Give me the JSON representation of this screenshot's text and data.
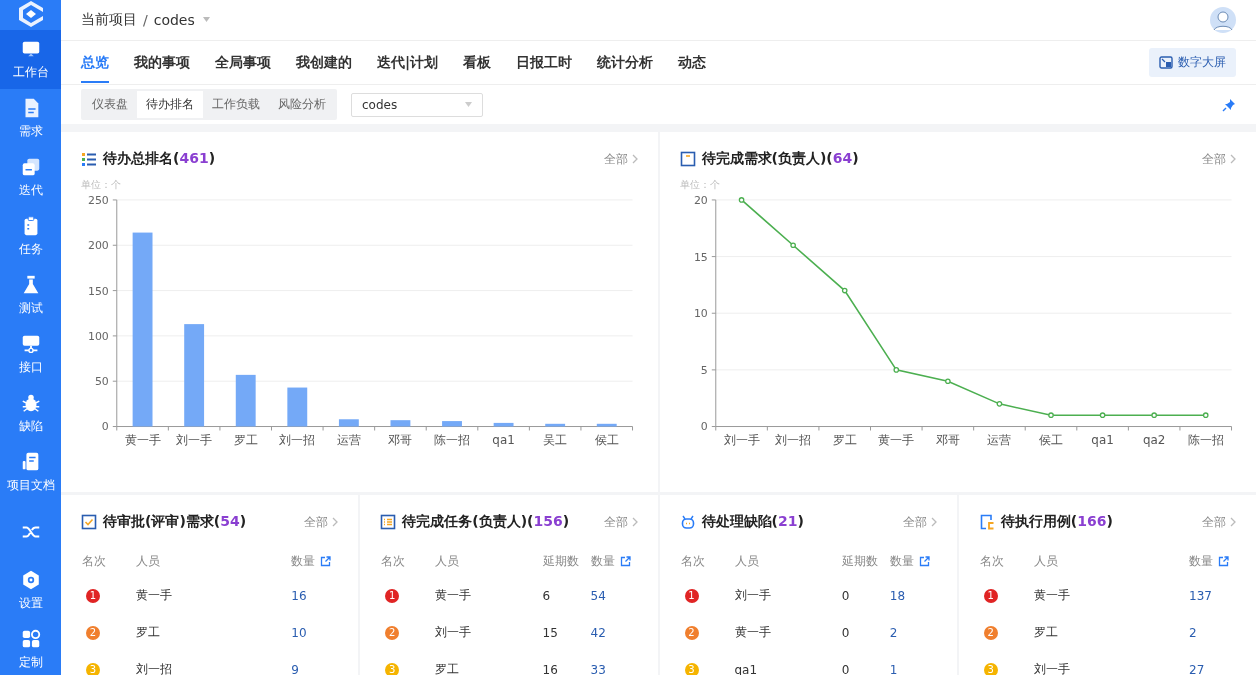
{
  "sidebar": {
    "items": [
      {
        "label": "工作台",
        "selected": true
      },
      {
        "label": "需求",
        "selected": false
      },
      {
        "label": "迭代",
        "selected": false
      },
      {
        "label": "任务",
        "selected": false
      },
      {
        "label": "测试",
        "selected": false
      },
      {
        "label": "接口",
        "selected": false
      },
      {
        "label": "缺陷",
        "selected": false
      },
      {
        "label": "项目文档",
        "selected": false
      },
      {
        "selected": false
      },
      {
        "label": "设置",
        "selected": false
      },
      {
        "label": "定制",
        "selected": false
      }
    ]
  },
  "header": {
    "project_label": "当前项目",
    "separator": "/",
    "project": "codes"
  },
  "tabs": [
    {
      "label": "总览",
      "selected": true
    },
    {
      "label": "我的事项",
      "selected": false
    },
    {
      "label": "全局事项",
      "selected": false
    },
    {
      "label": "我创建的",
      "selected": false
    },
    {
      "label": "迭代|计划",
      "selected": false
    },
    {
      "label": "看板",
      "selected": false
    },
    {
      "label": "日报工时",
      "selected": false
    },
    {
      "label": "统计分析",
      "selected": false
    },
    {
      "label": "动态",
      "selected": false
    }
  ],
  "big_screen_button": "数字大屏",
  "subtabs": [
    {
      "label": "仪表盘",
      "selected": false
    },
    {
      "label": "待办排名",
      "selected": true
    },
    {
      "label": "工作负载",
      "selected": false
    },
    {
      "label": "风险分析",
      "selected": false
    }
  ],
  "project_select": {
    "value": "codes"
  },
  "charts": [
    {
      "title": "待办总排名",
      "open": "(",
      "count": "461",
      "close": ")",
      "more": "全部",
      "unit": "单位：个",
      "chart_data": {
        "type": "bar",
        "categories": [
          "黄一手",
          "刘一手",
          "罗工",
          "刘一招",
          "运营",
          "邓哥",
          "陈一招",
          "qa1",
          "吴工",
          "侯工"
        ],
        "series": [
          {
            "color": "#74a9f7",
            "values": [
              214,
              113,
              57,
              43,
              8,
              7,
              6,
              4,
              3,
              3
            ]
          }
        ],
        "grid": true,
        "ylim": [
          0,
          250
        ],
        "yticks": [
          0,
          50,
          100,
          150,
          200,
          250
        ]
      }
    },
    {
      "title": "待完成需求(负责人)",
      "open": "(",
      "count": "64",
      "close": ")",
      "more": "全部",
      "unit": "单位：个",
      "chart_data": {
        "type": "line",
        "categories": [
          "刘一手",
          "刘一招",
          "罗工",
          "黄一手",
          "邓哥",
          "运营",
          "侯工",
          "qa1",
          "qa2",
          "陈一招"
        ],
        "series": [
          {
            "color": "#4caf50",
            "marker": true,
            "values": [
              20,
              16,
              12,
              5,
              4,
              2,
              1,
              1,
              1,
              1
            ]
          }
        ],
        "grid": true,
        "ylim": [
          0,
          20
        ],
        "yticks": [
          0,
          5,
          10,
          15,
          20
        ]
      }
    }
  ],
  "tables": [
    {
      "title": "待审批(评审)需求",
      "open": "(",
      "count": "54",
      "close": ")",
      "more": "全部",
      "columns": [
        "名次",
        "人员",
        "数量"
      ],
      "rows": [
        {
          "cells": [
            "1",
            "黄一手",
            "16"
          ]
        },
        {
          "cells": [
            "2",
            "罗工",
            "10"
          ]
        },
        {
          "cells": [
            "3",
            "刘一招",
            "9"
          ]
        }
      ]
    },
    {
      "title": "待完成任务(负责人)",
      "open": "(",
      "count": "156",
      "close": ")",
      "more": "全部",
      "columns": [
        "名次",
        "人员",
        "延期数",
        "数量"
      ],
      "rows": [
        {
          "cells": [
            "1",
            "黄一手",
            "6",
            "54"
          ]
        },
        {
          "cells": [
            "2",
            "刘一手",
            "15",
            "42"
          ]
        },
        {
          "cells": [
            "3",
            "罗工",
            "16",
            "33"
          ]
        }
      ]
    },
    {
      "title": "待处理缺陷",
      "open": "(",
      "count": "21",
      "close": ")",
      "more": "全部",
      "columns": [
        "名次",
        "人员",
        "延期数",
        "数量"
      ],
      "rows": [
        {
          "cells": [
            "1",
            "刘一手",
            "0",
            "18"
          ]
        },
        {
          "cells": [
            "2",
            "黄一手",
            "0",
            "2"
          ]
        },
        {
          "cells": [
            "3",
            "qa1",
            "0",
            "1"
          ]
        }
      ]
    },
    {
      "title": "待执行用例",
      "open": "(",
      "count": "166",
      "close": ")",
      "more": "全部",
      "columns": [
        "名次",
        "人员",
        "数量"
      ],
      "rows": [
        {
          "cells": [
            "1",
            "黄一手",
            "137"
          ]
        },
        {
          "cells": [
            "2",
            "罗工",
            "2"
          ]
        },
        {
          "cells": [
            "3",
            "刘一手",
            "27"
          ]
        }
      ]
    }
  ]
}
